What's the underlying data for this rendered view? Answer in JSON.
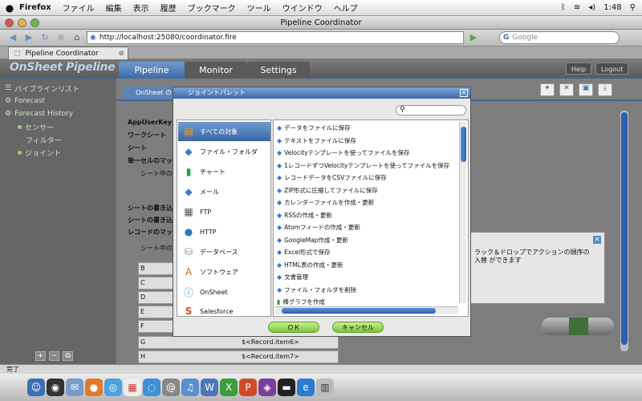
{
  "menubar": {
    "app": "Firefox",
    "items": [
      "ファイル",
      "編集",
      "表示",
      "履歴",
      "ブックマーク",
      "ツール",
      "ウインドウ",
      "ヘルプ"
    ],
    "clock": "1:48"
  },
  "window": {
    "title": "Pipeline Coordinator"
  },
  "browser": {
    "url": "http://localhost:25080/coordinator.fire",
    "search_placeholder": "Google",
    "tab_label": "Pipeline Coordinator"
  },
  "app": {
    "logo": "OnSheet Pipeline",
    "tabs": [
      "Pipeline",
      "Monitor",
      "Settings"
    ],
    "help": "Help",
    "logout": "Logout"
  },
  "sidebar": {
    "items": [
      {
        "label": "パイプラインリスト"
      },
      {
        "label": "Forecast"
      },
      {
        "label": "Forecast History"
      },
      {
        "label": "センサー"
      },
      {
        "label": "フィルター"
      },
      {
        "label": "ジョイント"
      }
    ]
  },
  "main": {
    "subtab": "OnSheet の",
    "labels": [
      "AppUserKey",
      "ワークシート",
      "シート",
      "単一セルのマッ",
      "シート中の",
      "シートの書き込",
      "シートの書き込",
      "レコードのマッ",
      "シート中の"
    ],
    "grid_rows": [
      {
        "key": "B",
        "value": ""
      },
      {
        "key": "C",
        "value": ""
      },
      {
        "key": "D",
        "value": ""
      },
      {
        "key": "E",
        "value": ""
      },
      {
        "key": "F",
        "value": ""
      },
      {
        "key": "G",
        "value": "$<Record.item6>"
      },
      {
        "key": "H",
        "value": "$<Record.item7>"
      }
    ]
  },
  "modal": {
    "title": "ジョイントパレット",
    "categories": [
      {
        "label": "すべての対象",
        "icon": "stack-icon"
      },
      {
        "label": "ファイル・フォルダ",
        "icon": "file-icon"
      },
      {
        "label": "チャート",
        "icon": "chart-icon"
      },
      {
        "label": "メール",
        "icon": "mail-icon"
      },
      {
        "label": "FTP",
        "icon": "ftp-icon"
      },
      {
        "label": "HTTP",
        "icon": "globe-icon"
      },
      {
        "label": "データベース",
        "icon": "database-icon"
      },
      {
        "label": "ソフトウェア",
        "icon": "software-icon"
      },
      {
        "label": "OnSheet",
        "icon": "info-icon"
      },
      {
        "label": "Salesforce",
        "icon": "salesforce-icon"
      }
    ],
    "actions": [
      "データをファイルに保存",
      "テキストをファイルに保存",
      "Velocityテンプレートを使ってファイルを保存",
      "1レコードずつVelocityテンプレートを使ってファイルを保存",
      "レコードデータをCSVファイルに保存",
      "ZIP形式に圧縮してファイルに保存",
      "カレンダーファイルを作成・更新",
      "RSSの作成・更新",
      "Atomフィードの作成・更新",
      "GoogleMap作成・更新",
      "Excel形式で保存",
      "HTML表の作成・更新",
      "文書管理",
      "ファイル・フォルダを削除",
      "棒グラフを作成"
    ],
    "ok": "ＯＫ",
    "cancel": "キャンセル"
  },
  "hint": {
    "text": "ラック＆ドロップでアクションの順序の入替 ができます"
  },
  "status": {
    "text": "完了"
  },
  "colors": {
    "accent": "#3f6aa8",
    "button_green": "#7dc43d"
  }
}
